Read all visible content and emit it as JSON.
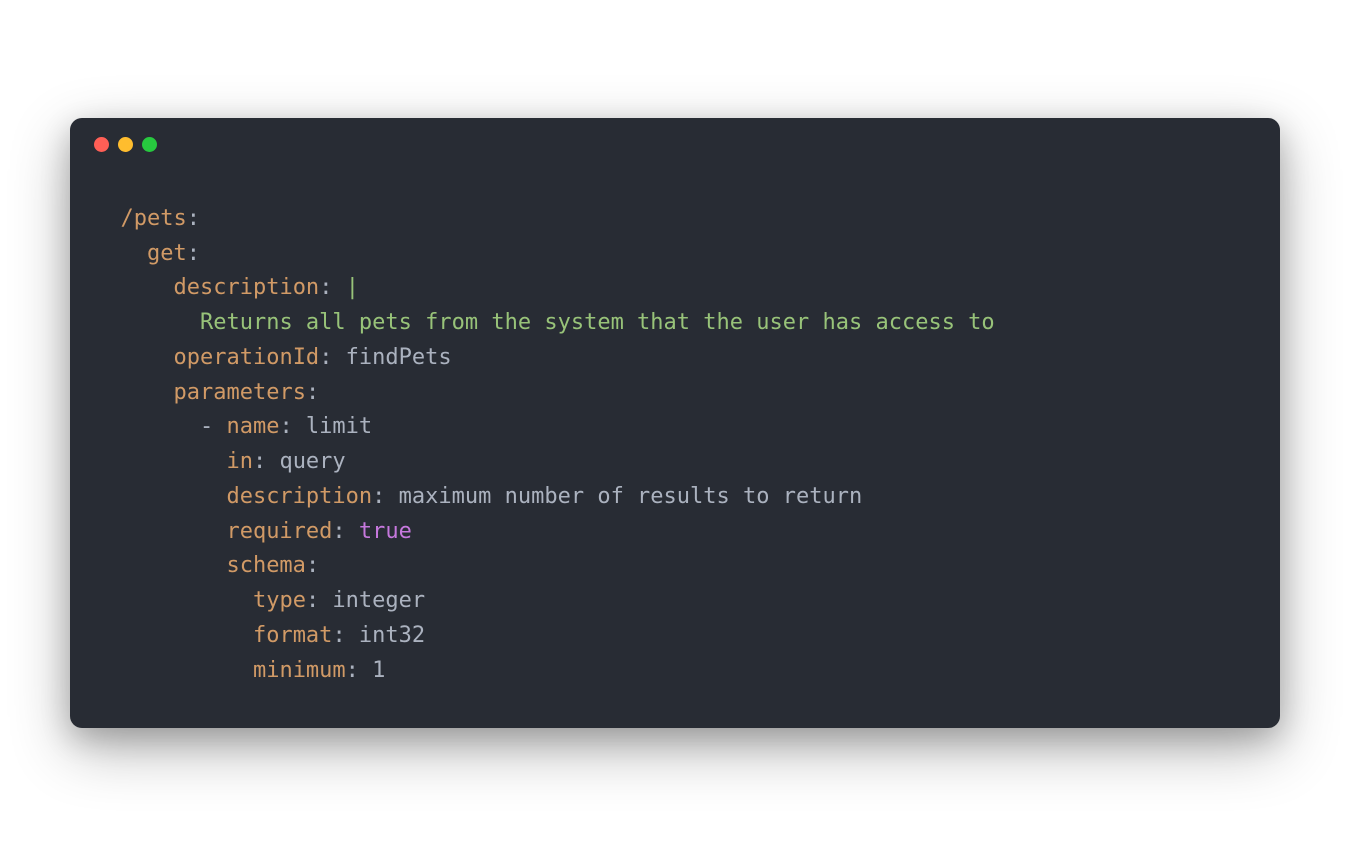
{
  "window": {
    "traffic_lights": [
      "red",
      "yellow",
      "green"
    ]
  },
  "code": {
    "tokens": [
      [
        {
          "t": "plain",
          "v": "  "
        },
        {
          "t": "key",
          "v": "/pets"
        },
        {
          "t": "plain",
          "v": ":"
        }
      ],
      [
        {
          "t": "plain",
          "v": "    "
        },
        {
          "t": "key",
          "v": "get"
        },
        {
          "t": "plain",
          "v": ":"
        }
      ],
      [
        {
          "t": "plain",
          "v": "      "
        },
        {
          "t": "key",
          "v": "description"
        },
        {
          "t": "plain",
          "v": ": "
        },
        {
          "t": "string",
          "v": "|"
        }
      ],
      [
        {
          "t": "plain",
          "v": "        "
        },
        {
          "t": "string",
          "v": "Returns all pets from the system that the user has access to"
        }
      ],
      [
        {
          "t": "plain",
          "v": "      "
        },
        {
          "t": "key",
          "v": "operationId"
        },
        {
          "t": "plain",
          "v": ": findPets"
        }
      ],
      [
        {
          "t": "plain",
          "v": "      "
        },
        {
          "t": "key",
          "v": "parameters"
        },
        {
          "t": "plain",
          "v": ":"
        }
      ],
      [
        {
          "t": "plain",
          "v": "        - "
        },
        {
          "t": "key",
          "v": "name"
        },
        {
          "t": "plain",
          "v": ": limit"
        }
      ],
      [
        {
          "t": "plain",
          "v": "          "
        },
        {
          "t": "key",
          "v": "in"
        },
        {
          "t": "plain",
          "v": ": query"
        }
      ],
      [
        {
          "t": "plain",
          "v": "          "
        },
        {
          "t": "key",
          "v": "description"
        },
        {
          "t": "plain",
          "v": ": maximum number of results to return"
        }
      ],
      [
        {
          "t": "plain",
          "v": "          "
        },
        {
          "t": "key",
          "v": "required"
        },
        {
          "t": "plain",
          "v": ": "
        },
        {
          "t": "const",
          "v": "true"
        }
      ],
      [
        {
          "t": "plain",
          "v": "          "
        },
        {
          "t": "key",
          "v": "schema"
        },
        {
          "t": "plain",
          "v": ":"
        }
      ],
      [
        {
          "t": "plain",
          "v": "            "
        },
        {
          "t": "key",
          "v": "type"
        },
        {
          "t": "plain",
          "v": ": integer"
        }
      ],
      [
        {
          "t": "plain",
          "v": "            "
        },
        {
          "t": "key",
          "v": "format"
        },
        {
          "t": "plain",
          "v": ": int32"
        }
      ],
      [
        {
          "t": "plain",
          "v": "            "
        },
        {
          "t": "key",
          "v": "minimum"
        },
        {
          "t": "plain",
          "v": ": "
        },
        {
          "t": "num",
          "v": "1"
        }
      ]
    ]
  }
}
